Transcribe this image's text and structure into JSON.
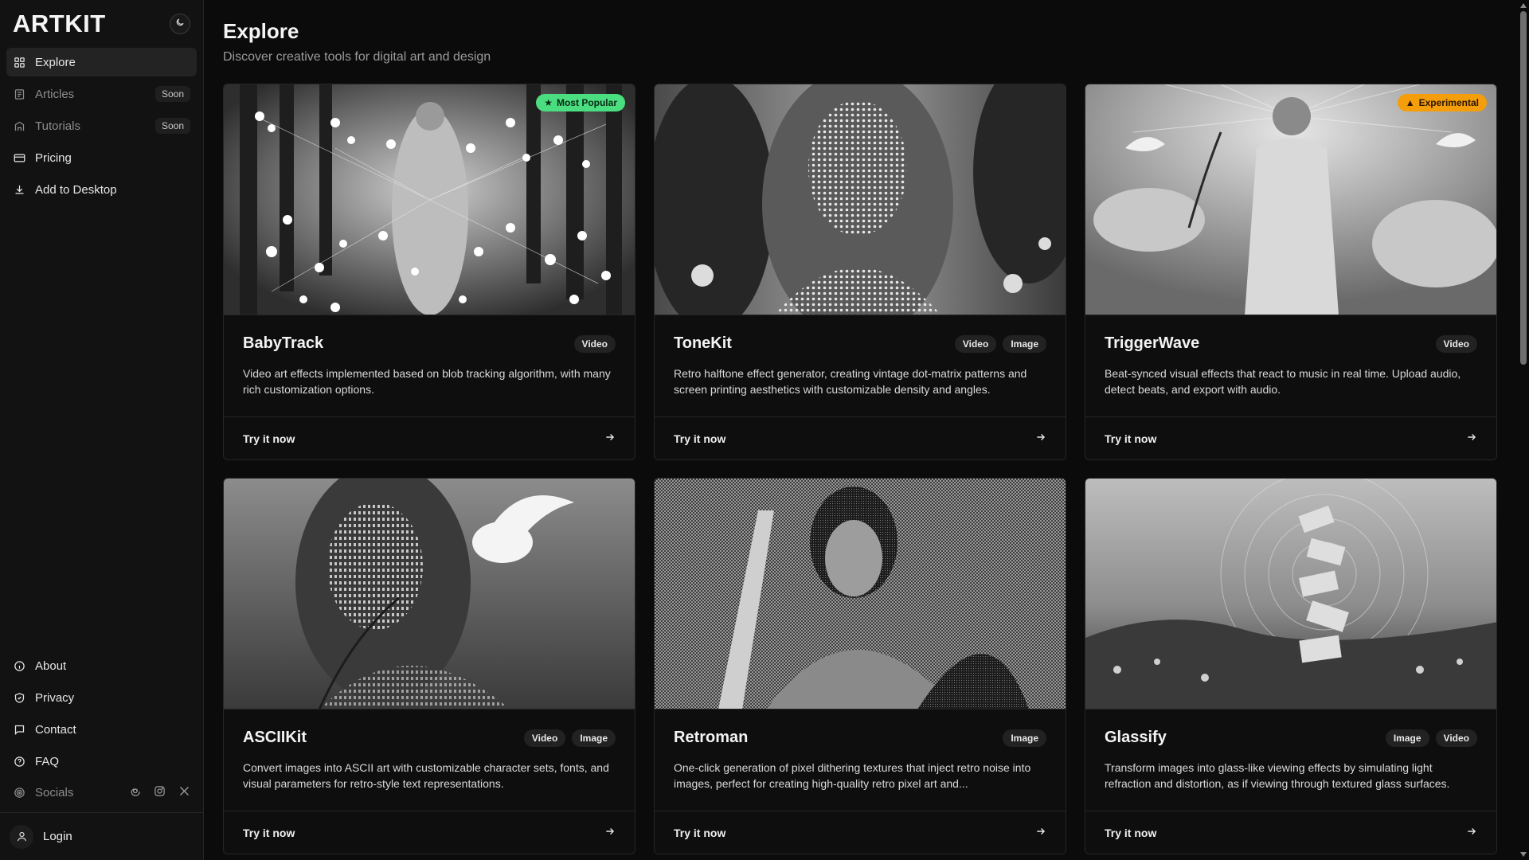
{
  "sidebar": {
    "brand": "ARTKIT",
    "nav": [
      {
        "label": "Explore",
        "active": true,
        "icon": "grid-icon"
      },
      {
        "label": "Articles",
        "badge": "Soon",
        "muted": true,
        "icon": "newspaper-icon"
      },
      {
        "label": "Tutorials",
        "badge": "Soon",
        "muted": true,
        "icon": "school-icon"
      },
      {
        "label": "Pricing",
        "icon": "credit-card-icon"
      },
      {
        "label": "Add to Desktop",
        "icon": "download-icon"
      }
    ],
    "bottom": [
      {
        "label": "About",
        "icon": "info-icon"
      },
      {
        "label": "Privacy",
        "icon": "shield-icon"
      },
      {
        "label": "Contact",
        "icon": "message-icon"
      },
      {
        "label": "FAQ",
        "icon": "help-icon"
      }
    ],
    "socials_label": "Socials",
    "socials": [
      "threads-icon",
      "instagram-icon",
      "x-icon"
    ],
    "login_label": "Login"
  },
  "main": {
    "title": "Explore",
    "subtitle": "Discover creative tools for digital art and design",
    "cards": [
      {
        "title": "BabyTrack",
        "tags": [
          "Video"
        ],
        "badge": "Most Popular",
        "badge_color": "#4ade80",
        "desc": "Video art effects implemented based on blob tracking algorithm, with many rich customization options.",
        "cta": "Try it now"
      },
      {
        "title": "ToneKit",
        "tags": [
          "Video",
          "Image"
        ],
        "desc": "Retro halftone effect generator, creating vintage dot-matrix patterns and screen printing aesthetics with customizable density and angles.",
        "cta": "Try it now"
      },
      {
        "title": "TriggerWave",
        "tags": [
          "Video"
        ],
        "badge": "Experimental",
        "badge_color": "#f59e0b",
        "desc": "Beat-synced visual effects that react to music in real time. Upload audio, detect beats, and export with audio.",
        "cta": "Try it now"
      },
      {
        "title": "ASCIIKit",
        "tags": [
          "Video",
          "Image"
        ],
        "desc": "Convert images into ASCII art with customizable character sets, fonts, and visual parameters for retro-style text representations.",
        "cta": "Try it now"
      },
      {
        "title": "Retroman",
        "tags": [
          "Image"
        ],
        "desc": "One-click generation of pixel dithering textures that inject retro noise into images, perfect for creating high-quality retro pixel art and...",
        "cta": "Try it now"
      },
      {
        "title": "Glassify",
        "tags": [
          "Image",
          "Video"
        ],
        "desc": "Transform images into glass-like viewing effects by simulating light refraction and distortion, as if viewing through textured glass surfaces.",
        "cta": "Try it now"
      }
    ]
  },
  "colors": {
    "background": "#0b0b0b",
    "sidebar": "#121212",
    "border": "#262626",
    "accent_green": "#4ade80",
    "accent_orange": "#f59e0b"
  }
}
